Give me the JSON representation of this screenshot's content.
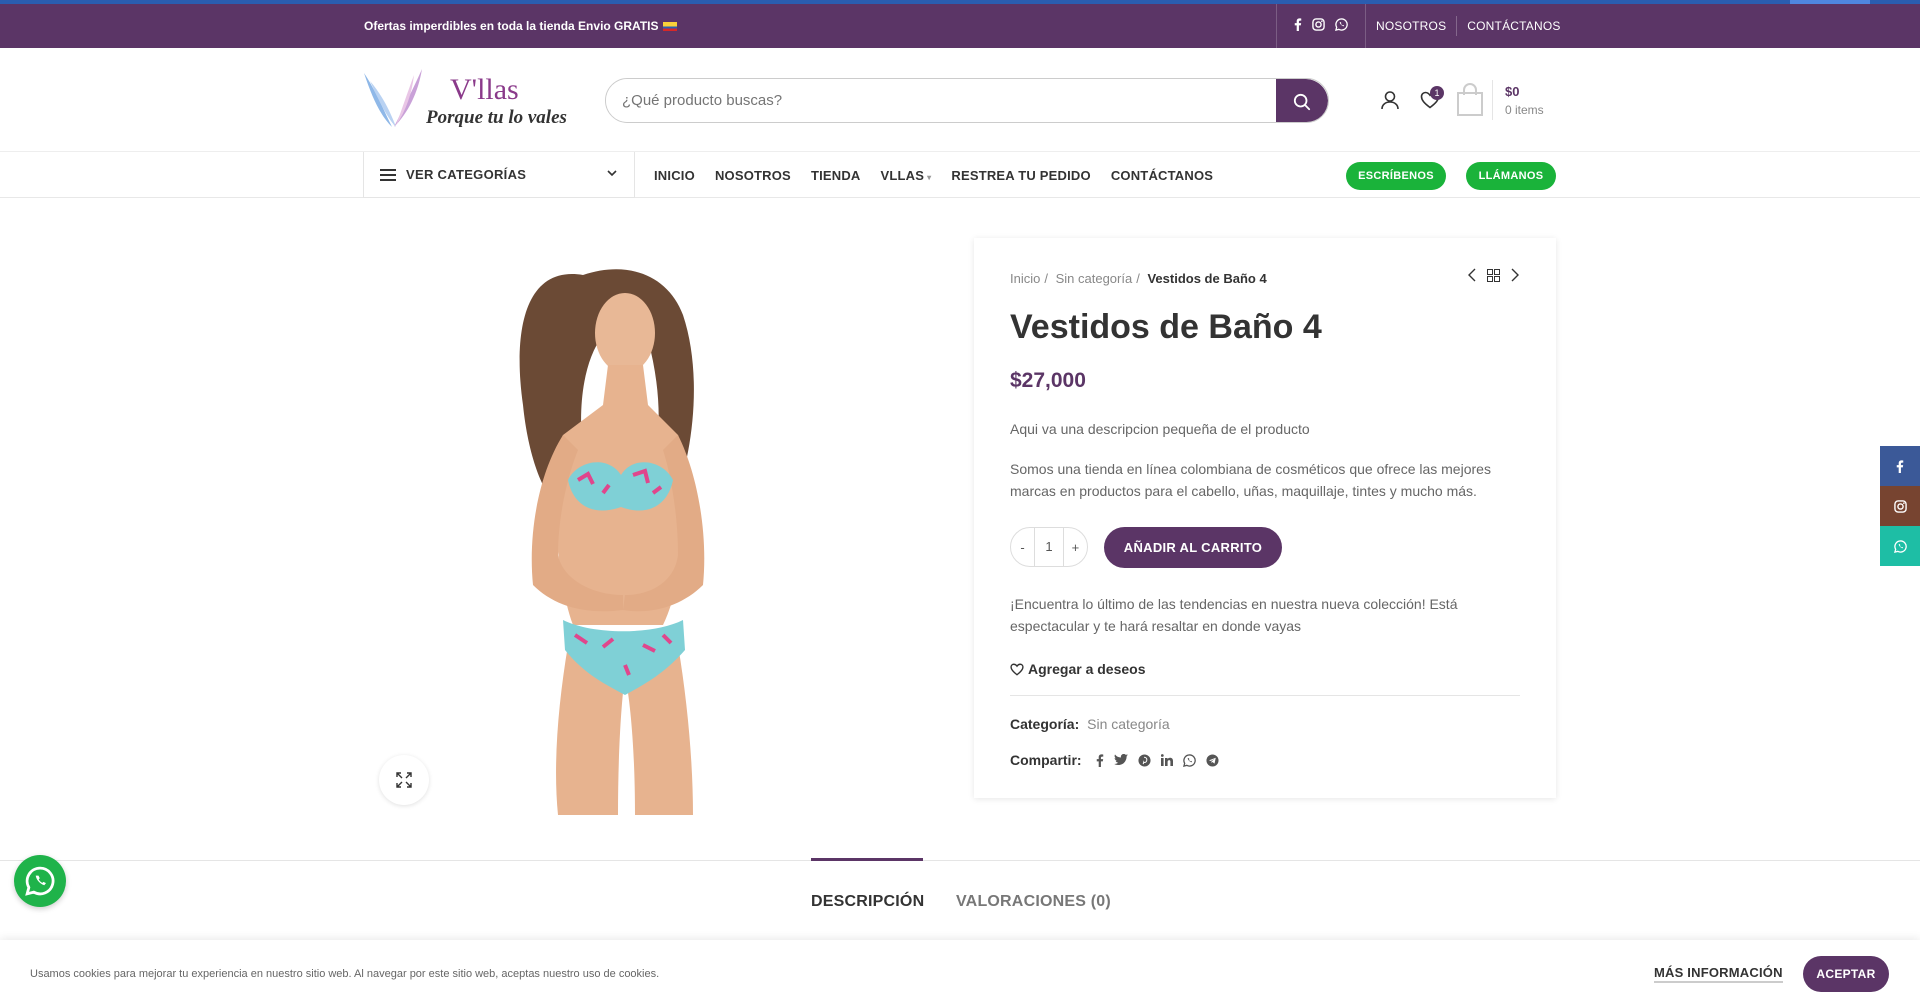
{
  "topbar": {
    "promo": "Ofertas imperdibles en toda la tienda Envio GRATIS",
    "links": [
      "NOSOTROS",
      "CONTÁCTANOS"
    ],
    "bg_color": "#5b3566"
  },
  "header": {
    "logo_brand": "V'llas",
    "logo_tagline": "Porque tu lo vales",
    "search_placeholder": "¿Qué producto buscas?",
    "wishlist_count": "1",
    "cart_total": "$0",
    "cart_items": "0 items"
  },
  "nav": {
    "categories_label": "VER CATEGORÍAS",
    "menu": [
      {
        "label": "INICIO"
      },
      {
        "label": "NOSOTROS"
      },
      {
        "label": "TIENDA"
      },
      {
        "label": "VLLAS"
      },
      {
        "label": "RESTREA TU PEDIDO"
      },
      {
        "label": "CONTÁCTANOS"
      }
    ],
    "write_label": "ESCRÍBENOS",
    "call_label": "LLÁMANOS"
  },
  "product": {
    "breadcrumb": [
      "Inicio",
      "Sin categoría",
      "Vestidos de Baño 4"
    ],
    "title": "Vestidos de Baño 4",
    "price": "$27,000",
    "short_description": "Aqui va una descripcion pequeña de el producto",
    "description": "Somos una tienda en línea colombiana de cosméticos que ofrece las mejores marcas en productos para el cabello, uñas, maquillaje, tintes y mucho más.",
    "quantity": "1",
    "qty_minus": "-",
    "qty_plus": "+",
    "add_to_cart": "AÑADIR AL CARRITO",
    "promo_text": "¡Encuentra lo último de las tendencias en nuestra nueva colección! Está espectacular y te hará resaltar en donde vayas",
    "wishlist_label": "Agregar a deseos",
    "category_label": "Categoría:",
    "category_value": "Sin categoría",
    "share_label": "Compartir:"
  },
  "tabs": [
    {
      "label": "DESCRIPCIÓN",
      "active": true
    },
    {
      "label": "VALORACIONES (0)",
      "active": false
    }
  ],
  "cookie": {
    "text": "Usamos cookies para mejorar tu experiencia en nuestro sitio web. Al navegar por este sitio web, aceptas nuestro uso de cookies.",
    "more": "MÁS INFORMACIÓN",
    "accept": "ACEPTAR"
  },
  "colors": {
    "accent": "#5b3566",
    "green": "#1ab33a",
    "facebook": "#3b5998",
    "instagram": "#774430",
    "whatsapp": "#1ebea5"
  }
}
